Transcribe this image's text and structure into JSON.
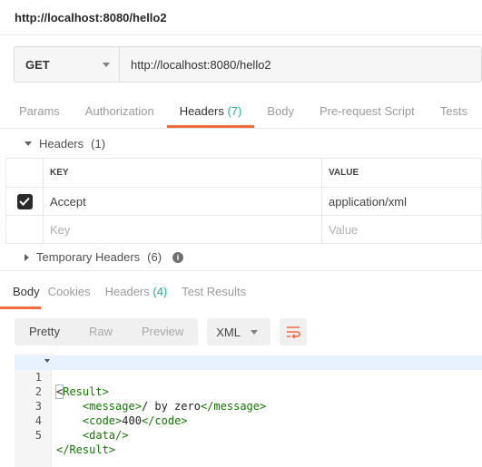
{
  "window": {
    "title": "http://localhost:8080/hello2"
  },
  "request": {
    "method": "GET",
    "url": "http://localhost:8080/hello2",
    "tabs": [
      {
        "label": "Params",
        "count": ""
      },
      {
        "label": "Authorization",
        "count": ""
      },
      {
        "label": "Headers",
        "count": "(7)"
      },
      {
        "label": "Body",
        "count": ""
      },
      {
        "label": "Pre-request Script",
        "count": ""
      },
      {
        "label": "Tests",
        "count": ""
      }
    ],
    "active_tab": "Headers"
  },
  "headers_section": {
    "title": "Headers",
    "count": "(1)",
    "columns": {
      "key": "KEY",
      "value": "VALUE"
    },
    "rows": [
      {
        "key": "Accept",
        "value": "application/xml",
        "checked": true
      }
    ],
    "placeholder": {
      "key": "Key",
      "value": "Value"
    }
  },
  "temporary_headers": {
    "label": "Temporary Headers",
    "count": "(6)",
    "info": "i"
  },
  "response": {
    "tabs": [
      {
        "label": "Body",
        "count": ""
      },
      {
        "label": "Cookies",
        "count": ""
      },
      {
        "label": "Headers",
        "count": "(4)"
      },
      {
        "label": "Test Results",
        "count": ""
      }
    ],
    "active_tab": "Body",
    "view_modes": [
      "Pretty",
      "Raw",
      "Preview"
    ],
    "active_view": "Pretty",
    "format": "XML",
    "code_lines": [
      {
        "n": "1",
        "open": "<",
        "tag": "Result",
        "close": ">",
        "text": ""
      },
      {
        "n": "2",
        "text": "    <message>/ by zero</message>"
      },
      {
        "n": "3",
        "text": "    <code>400</code>"
      },
      {
        "n": "4",
        "text": "    <data/>"
      },
      {
        "n": "5",
        "text": "</Result>"
      }
    ]
  },
  "colors": {
    "accent": "#f26b3a",
    "count_green": "#26b47f",
    "xml_tag": "#117700"
  }
}
